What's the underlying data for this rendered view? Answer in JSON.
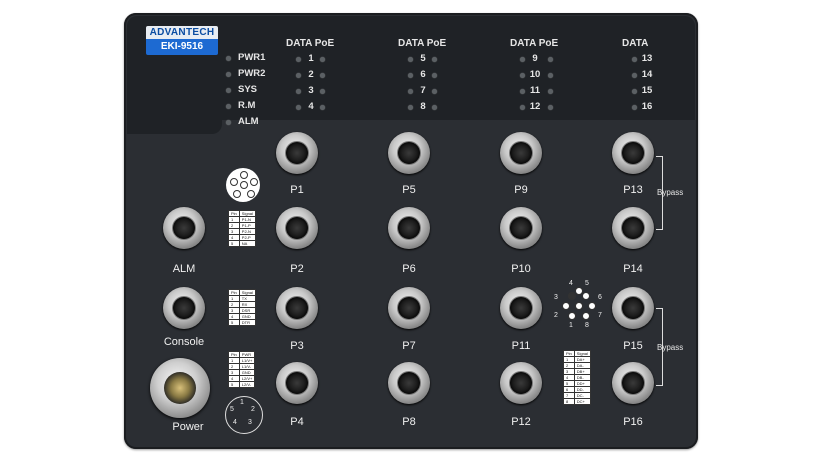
{
  "brand": {
    "logo_top": "ADVANTECH",
    "model": "EKI-9516"
  },
  "status_leds": [
    "PWR1",
    "PWR2",
    "SYS",
    "R.M",
    "ALM"
  ],
  "led_headers": [
    "DATA PoE",
    "DATA PoE",
    "DATA PoE",
    "DATA"
  ],
  "led_numbers": {
    "col1": [
      "1",
      "2",
      "3",
      "4"
    ],
    "col2": [
      "5",
      "6",
      "7",
      "8"
    ],
    "col3": [
      "9",
      "10",
      "11",
      "12"
    ],
    "col4": [
      "13",
      "14",
      "15",
      "16"
    ]
  },
  "ports": [
    "P1",
    "P2",
    "P3",
    "P4",
    "P5",
    "P6",
    "P7",
    "P8",
    "P9",
    "P10",
    "P11",
    "P12",
    "P13",
    "P14",
    "P15",
    "P16"
  ],
  "side_connectors": {
    "alm": "ALM",
    "console": "Console",
    "power": "Power"
  },
  "bypass_label": "Bypass",
  "alm_table": {
    "header": [
      "Pin",
      "Signal"
    ],
    "rows": [
      [
        "1",
        "P1-N"
      ],
      [
        "2",
        "P1-P"
      ],
      [
        "3",
        "P2-N"
      ],
      [
        "4",
        "P2-P"
      ],
      [
        "5",
        "NA"
      ]
    ]
  },
  "console_table": {
    "header": [
      "Pin",
      "Signal"
    ],
    "rows": [
      [
        "1",
        "TX"
      ],
      [
        "2",
        "RX"
      ],
      [
        "3",
        "DSR"
      ],
      [
        "4",
        "GND"
      ],
      [
        "5",
        "DTR"
      ]
    ]
  },
  "power_table": {
    "header": [
      "Pin",
      "PWR"
    ],
    "rows": [
      [
        "1",
        "L1/V+"
      ],
      [
        "2",
        "L1/V-"
      ],
      [
        "3",
        "GND"
      ],
      [
        "4",
        "L2/V+"
      ],
      [
        "5",
        "L2/V-"
      ]
    ]
  },
  "data_table": {
    "header": [
      "Pin",
      "Signal"
    ],
    "rows": [
      [
        "1",
        "DA+"
      ],
      [
        "2",
        "DA-"
      ],
      [
        "3",
        "DB+"
      ],
      [
        "4",
        "DB-"
      ],
      [
        "5",
        "DD+"
      ],
      [
        "6",
        "DD-"
      ],
      [
        "7",
        "DC-"
      ],
      [
        "8",
        "DC+"
      ]
    ]
  },
  "pin_diagram_5": [
    "1",
    "2",
    "3",
    "4",
    "5"
  ],
  "pin_diagram_8": [
    "1",
    "2",
    "3",
    "4",
    "5",
    "6",
    "7",
    "8"
  ]
}
